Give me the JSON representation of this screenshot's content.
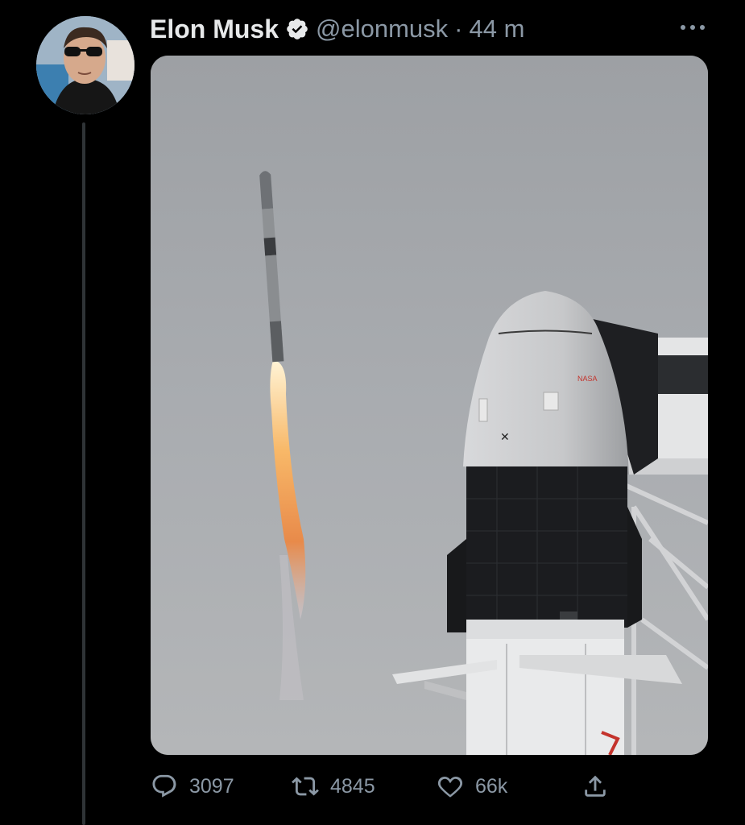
{
  "tweet": {
    "author_name": "Elon Musk",
    "handle": "@elonmusk",
    "separator": "·",
    "time": "44 m"
  },
  "actions": {
    "replies": "3097",
    "retweets": "4845",
    "likes": "66k"
  },
  "icons": {
    "verified": "verified-badge-icon",
    "more": "more-dots-icon",
    "reply": "reply-icon",
    "retweet": "retweet-icon",
    "like": "heart-icon",
    "share": "share-icon"
  },
  "colors": {
    "background": "#000000",
    "text_primary": "#e7e9ea",
    "text_secondary": "#8b98a5",
    "thread_line": "#2f3336"
  }
}
